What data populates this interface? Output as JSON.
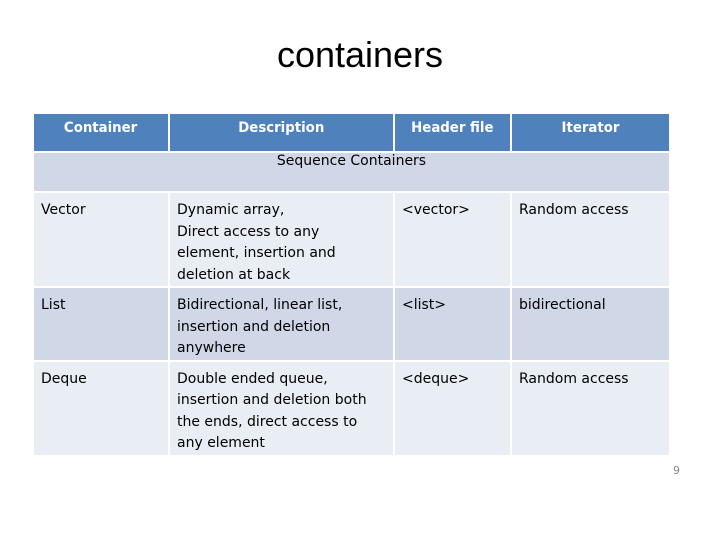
{
  "slide": {
    "title": "containers",
    "page_number": "9"
  },
  "table": {
    "headers": [
      "Container",
      "Description",
      "Header file",
      "Iterator"
    ],
    "section_label": "Sequence Containers",
    "rows": [
      {
        "container": "Vector",
        "description": [
          "Dynamic array,",
          "Direct access to any",
          "element, insertion and",
          "deletion at back"
        ],
        "header_file": "<vector>",
        "iterator": "Random access"
      },
      {
        "container": "List",
        "description": [
          "Bidirectional, linear list,",
          "insertion and deletion",
          "anywhere"
        ],
        "header_file": "<list>",
        "iterator": "bidirectional"
      },
      {
        "container": "Deque",
        "description": [
          "Double ended queue,",
          "insertion and deletion both",
          "the ends, direct access to",
          "any element"
        ],
        "header_file": "<deque>",
        "iterator": "Random access"
      }
    ]
  },
  "colors": {
    "header_bg": "#4f81bd",
    "band_dark": "#d0d8e8",
    "band_light": "#e9edf4"
  }
}
